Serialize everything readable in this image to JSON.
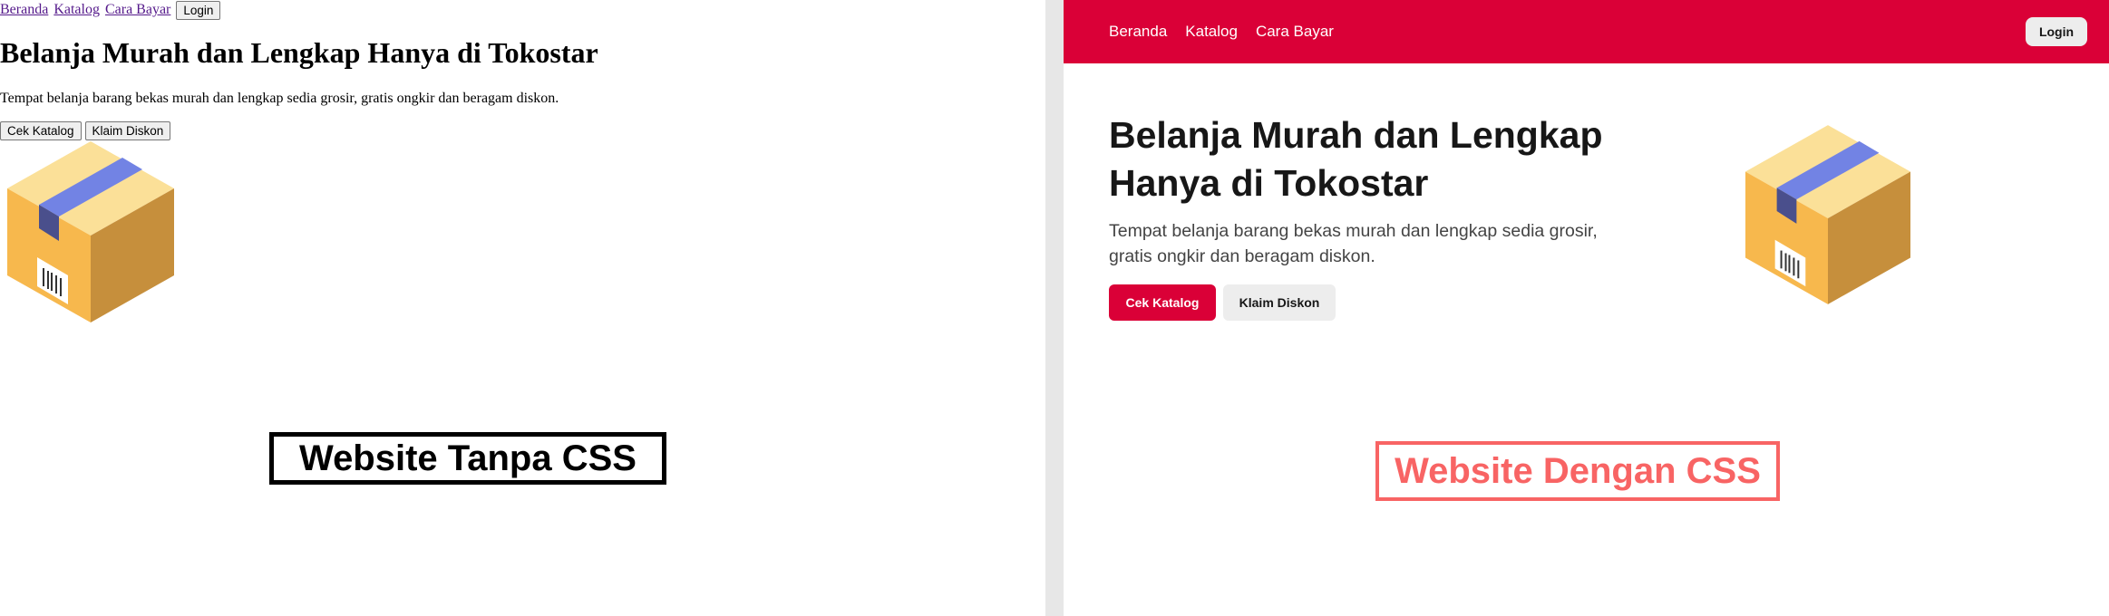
{
  "left_panel": {
    "nav": [
      "Beranda",
      "Katalog",
      "Cara Bayar"
    ],
    "login_label": "Login",
    "heading": "Belanja Murah dan Lengkap Hanya di Tokostar",
    "description": "Tempat belanja barang bekas murah dan lengkap sedia grosir, gratis ongkir dan beragam diskon.",
    "primary_button": "Cek Katalog",
    "secondary_button": "Klaim Diskon",
    "caption": "Website Tanpa CSS",
    "illustration_icon": "package-box-icon"
  },
  "right_panel": {
    "nav": [
      "Beranda",
      "Katalog",
      "Cara Bayar"
    ],
    "login_label": "Login",
    "heading": "Belanja Murah dan Lengkap Hanya di Tokostar",
    "description": "Tempat belanja barang bekas murah dan lengkap sedia grosir, gratis ongkir dan beragam diskon.",
    "primary_button": "Cek Katalog",
    "secondary_button": "Klaim Diskon",
    "caption": "Website Dengan CSS",
    "illustration_icon": "package-box-icon"
  },
  "colors": {
    "brand_red": "#da0037",
    "caption_red": "#f86464",
    "box_front": "#f7b84d",
    "box_side": "#c68f3c",
    "box_top": "#fbe098",
    "tape": "#7283e4",
    "tape_dark": "#4a4f8c"
  }
}
